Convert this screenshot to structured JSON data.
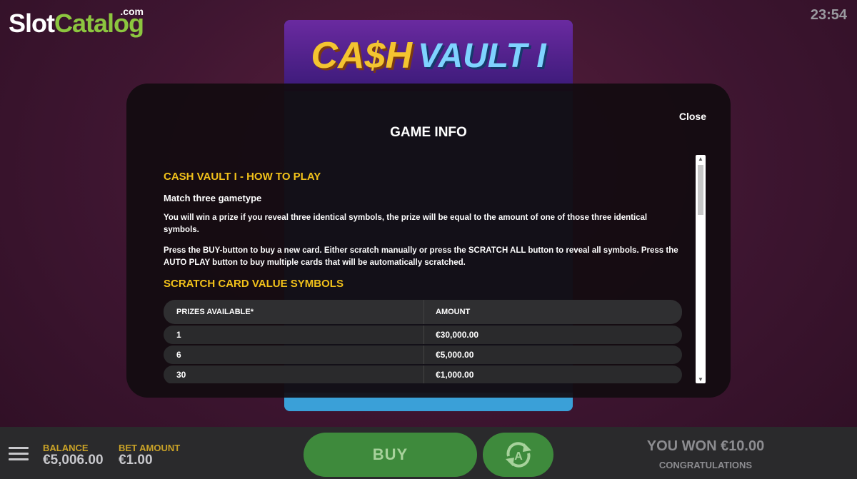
{
  "branding": {
    "logo_slot": "Slot",
    "logo_catalog": "Catalog",
    "logo_com": ".com"
  },
  "clock": "23:54",
  "game": {
    "title_part1": "CA$H",
    "title_part2": "VAULT I"
  },
  "modal": {
    "title": "GAME INFO",
    "close_label": "Close",
    "heading_how_to_play": "CASH VAULT I - HOW TO PLAY",
    "gametype": "Match three gametype",
    "para1": "You will win a prize if you reveal three identical symbols, the prize will be equal to the amount of one of those three identical symbols.",
    "para2": "Press the BUY-button to buy a new card. Either scratch manually or press the SCRATCH ALL button to reveal all symbols. Press the AUTO PLAY button to buy multiple cards that will be automatically scratched.",
    "heading_symbols": "SCRATCH CARD VALUE SYMBOLS",
    "table": {
      "col_prizes": "PRIZES AVAILABLE*",
      "col_amount": "AMOUNT",
      "rows": [
        {
          "prizes": "1",
          "amount": "€30,000.00"
        },
        {
          "prizes": "6",
          "amount": "€5,000.00"
        },
        {
          "prizes": "30",
          "amount": "€1,000.00"
        }
      ]
    }
  },
  "bottombar": {
    "balance_label": "BALANCE",
    "balance_value": "€5,006.00",
    "bet_label": "BET AMOUNT",
    "bet_value": "€1.00",
    "buy_label": "BUY",
    "won_text": "YOU WON €10.00",
    "congrats_text": "CONGRATULATIONS"
  }
}
